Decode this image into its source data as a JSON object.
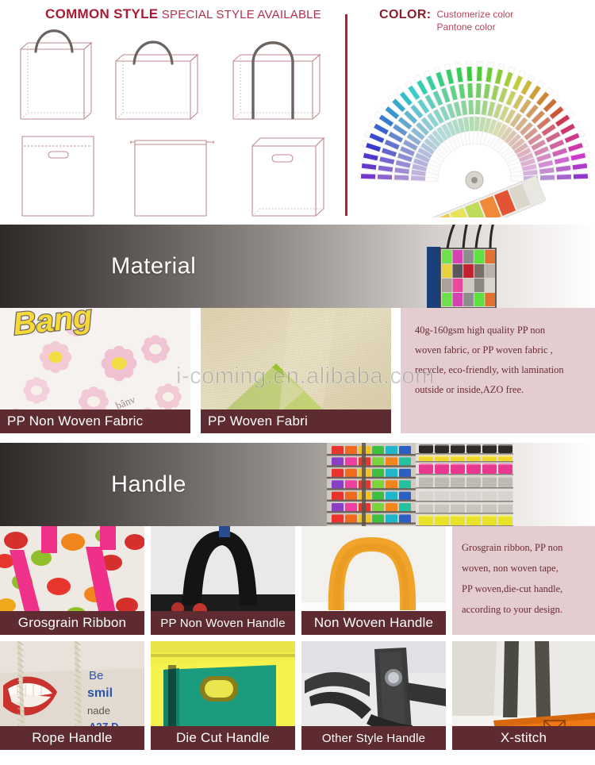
{
  "style_section": {
    "header_bold": "COMMON STYLE",
    "header_normal": " SPECIAL STYLE AVAILABLE",
    "color_header": "COLOR:",
    "color_lines": [
      "Customerize color",
      "Pantone color"
    ],
    "accent_color": "#a81a33",
    "divider_color": "#b11f36",
    "bag_outline_color": "#c08b90",
    "bag_handle_color": "#6b6460",
    "bags": [
      {
        "name": "tote-bag-tall-rope-handle",
        "row": 1,
        "col": 1
      },
      {
        "name": "tote-bag-wide-rope-handle",
        "row": 1,
        "col": 2
      },
      {
        "name": "tote-bag-large-strap-handle",
        "row": 1,
        "col": 3
      },
      {
        "name": "die-cut-handle-bag-stitched",
        "row": 2,
        "col": 1
      },
      {
        "name": "drawstring-bag",
        "row": 2,
        "col": 2
      },
      {
        "name": "die-cut-handle-box-bag",
        "row": 2,
        "col": 3
      }
    ],
    "fan_deck_name": "pantone-color-fan-deck"
  },
  "material_banner": {
    "title": "Material",
    "art_name": "photo-collage-shopping-bag"
  },
  "material_row": {
    "tiles": [
      {
        "caption": "PP Non Woven Fabric",
        "photo_name": "pp-non-woven-fabric-floral-print"
      },
      {
        "caption": "PP Woven Fabri",
        "photo_name": "pp-woven-fabric-beige-green"
      }
    ],
    "description": [
      "40g-160gsm high quality PP non",
      "woven fabric, or PP woven fabric ,",
      "recycle, eco-friendly, with lamination",
      "outside or inside,AZO free."
    ],
    "panel_color": "#e3cdd0",
    "caption_bar_color": "#5e2b31"
  },
  "handle_banner": {
    "title": "Handle",
    "art_name": "ribbon-spool-shelves"
  },
  "handle_row_1": {
    "tiles": [
      {
        "caption": "Grosgrain Ribbon",
        "photo_name": "pink-grosgrain-ribbon-handle-bag"
      },
      {
        "caption": "PP Non Woven Handle",
        "photo_name": "black-pp-non-woven-handle"
      },
      {
        "caption": "Non Woven Handle",
        "photo_name": "orange-non-woven-handle"
      }
    ],
    "description": [
      "Grosgrain ribbon, PP non",
      "woven, non woven tape,",
      "PP woven,die-cut handle,",
      "according to your design."
    ]
  },
  "handle_row_2": {
    "tiles": [
      {
        "caption": "Rope Handle",
        "photo_name": "rope-handle-printed-bag"
      },
      {
        "caption": "Die Cut Handle",
        "photo_name": "green-die-cut-handle-bag"
      },
      {
        "caption": "Other Style Handle",
        "photo_name": "black-snap-buckle-handle"
      },
      {
        "caption": "X-stitch",
        "photo_name": "x-stitch-handle-orange-bag"
      }
    ]
  },
  "watermark": {
    "text": "i-coming.en.alibaba.com"
  }
}
